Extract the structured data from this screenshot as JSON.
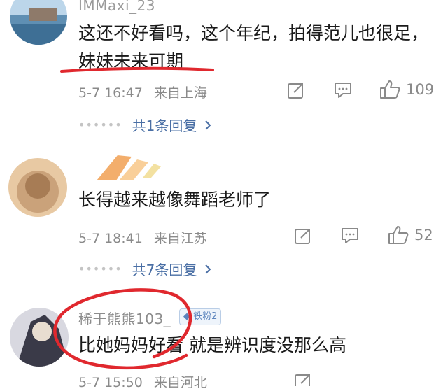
{
  "comments": [
    {
      "username": "IMMaxi_23",
      "text_line1": "这还不好看吗，这个年纪，拍得范儿也很足，",
      "text_line2": "妹妹未来可期",
      "time": "5-7 16:47",
      "location": "来自上海",
      "likes": "109",
      "replies_label": "共1条回复",
      "reply_dots": "••••••"
    },
    {
      "username": "",
      "text_line1": "长得越来越像舞蹈老师了",
      "time": "5-7 18:41",
      "location": "来自江苏",
      "likes": "52",
      "replies_label": "共7条回复",
      "reply_dots": "••••••"
    },
    {
      "username": "稀于熊熊103_",
      "badge": "铁粉2",
      "text_part1": "比她妈妈好看",
      "text_part2": " 就是辨识度没那么高",
      "time": "5-7 15:50",
      "location": "来自河北"
    }
  ],
  "icons": {
    "share": "share-icon",
    "comment": "comment-icon",
    "like": "thumbs-up-icon",
    "chevron": "chevron-right-icon"
  },
  "colors": {
    "annotation_red": "#e0282e",
    "link_blue": "#4a6fa5",
    "meta_gray": "#8a8a8a"
  }
}
